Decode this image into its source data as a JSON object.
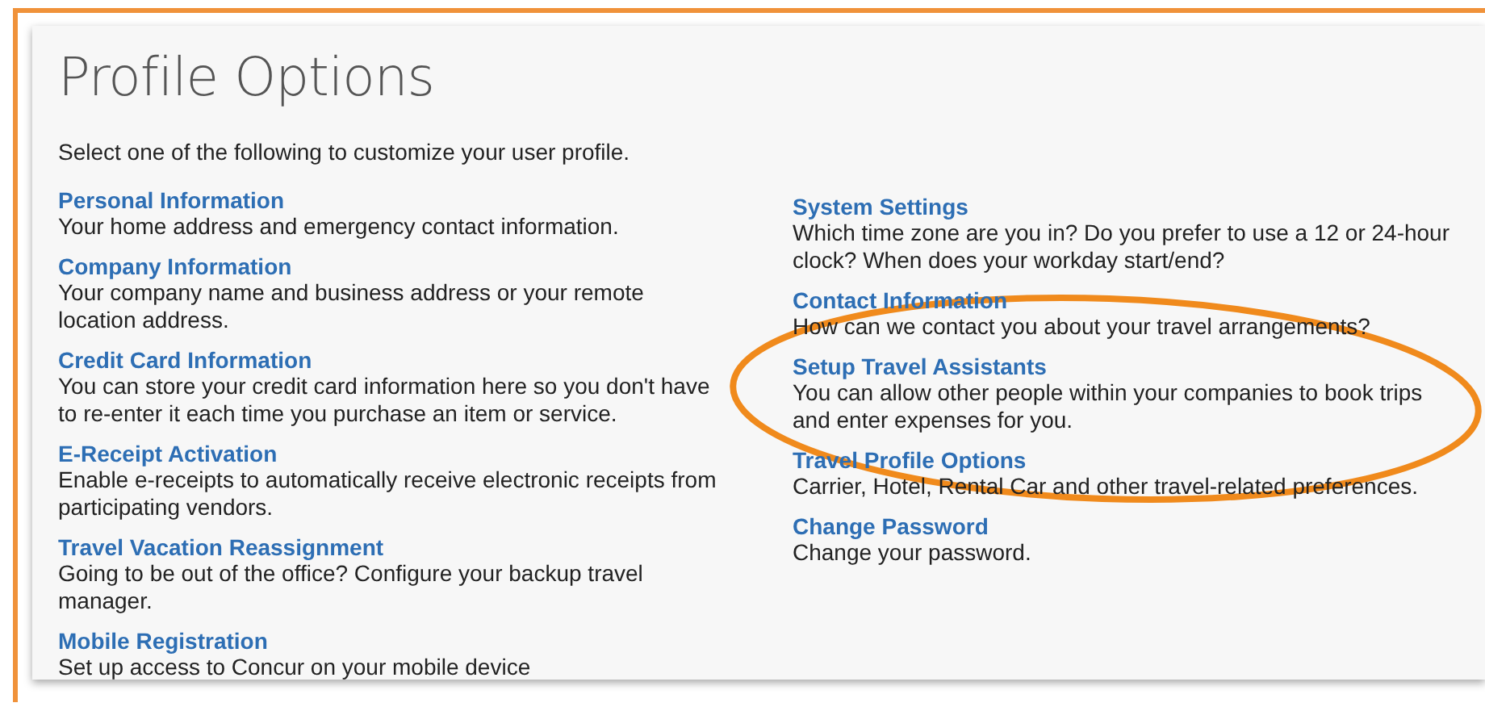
{
  "page": {
    "title": "Profile Options",
    "intro": "Select one of the following to customize your user profile."
  },
  "columns": [
    {
      "items": [
        {
          "title": "Personal Information",
          "description": "Your home address and emergency contact information.",
          "highlighted": false
        },
        {
          "title": "Company Information",
          "description": "Your company name and business address or your remote location address.",
          "highlighted": false
        },
        {
          "title": "Credit Card Information",
          "description": "You can store your credit card information here so you don't have to re-enter it each time you purchase an item or service.",
          "highlighted": false
        },
        {
          "title": "E-Receipt Activation",
          "description": "Enable e-receipts to automatically receive electronic receipts from participating vendors.",
          "highlighted": false
        },
        {
          "title": "Travel Vacation Reassignment",
          "description": "Going to be out of the office? Configure your backup travel manager.",
          "highlighted": false
        },
        {
          "title": "Mobile Registration",
          "description": "Set up access to Concur on your mobile device",
          "highlighted": false
        }
      ]
    },
    {
      "items": [
        {
          "title": "System Settings",
          "description": "Which time zone are you in? Do you prefer to use a 12 or 24-hour clock? When does your workday start/end?",
          "highlighted": false
        },
        {
          "title": "Contact Information",
          "description": "How can we contact you about your travel arrangements?",
          "highlighted": false
        },
        {
          "title": "Setup Travel Assistants",
          "description": "You can allow other people within your companies to book trips and enter expenses for you.",
          "highlighted": true
        },
        {
          "title": "Travel Profile Options",
          "description": "Carrier, Hotel, Rental Car and other travel-related preferences.",
          "highlighted": false
        },
        {
          "title": "Change Password",
          "description": "Change your password.",
          "highlighted": false
        }
      ]
    }
  ]
}
